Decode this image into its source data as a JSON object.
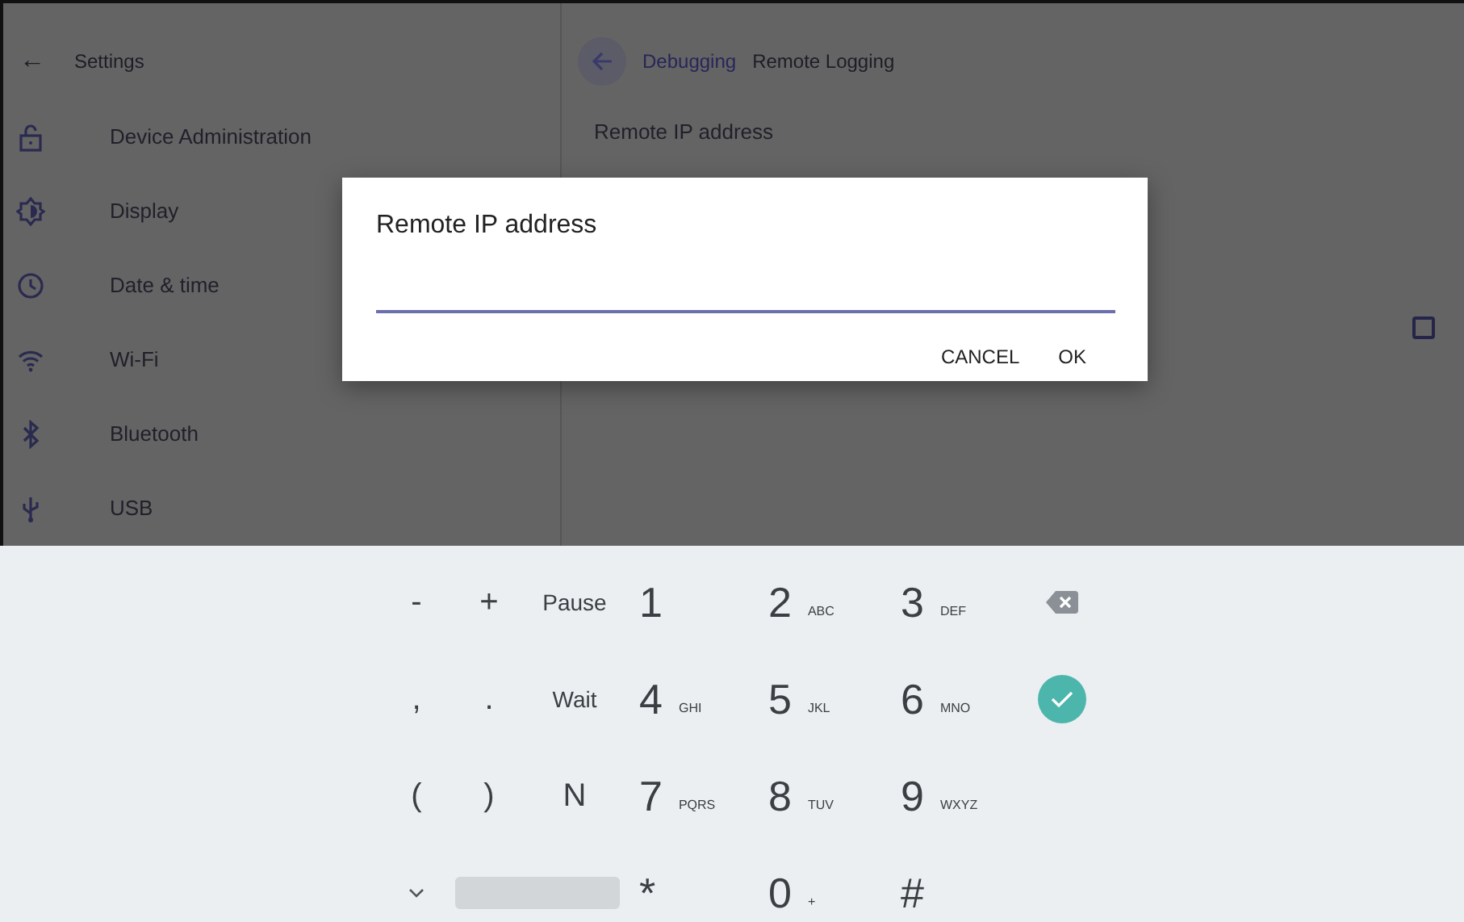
{
  "settings_panel": {
    "back": "←",
    "title": "Settings",
    "items": [
      {
        "label": "Device Administration"
      },
      {
        "label": "Display"
      },
      {
        "label": "Date & time"
      },
      {
        "label": "Wi-Fi"
      },
      {
        "label": "Bluetooth"
      },
      {
        "label": "USB"
      }
    ]
  },
  "detail_panel": {
    "breadcrumb": [
      {
        "label": "Debugging",
        "selected": false
      },
      {
        "label": "Remote Logging",
        "selected": true
      }
    ],
    "setting": {
      "label": "Remote IP address"
    },
    "checkbox": {
      "checked": false
    }
  },
  "dialog": {
    "title": "Remote IP address",
    "buttons": [
      "CANCEL",
      "OK"
    ]
  },
  "keypad": {
    "rows": [
      [
        {
          "kind": "text",
          "label": "-"
        },
        {
          "kind": "text",
          "label": "+"
        },
        {
          "kind": "word",
          "label": "Pause"
        },
        {
          "kind": "digit",
          "label": "1"
        },
        {
          "kind": "digit",
          "label": "2",
          "sub": "ABC"
        },
        {
          "kind": "digit",
          "label": "3",
          "sub": "DEF"
        },
        {
          "kind": "backspace"
        }
      ],
      [
        {
          "kind": "text",
          "label": ","
        },
        {
          "kind": "text",
          "label": "."
        },
        {
          "kind": "word",
          "label": "Wait"
        },
        {
          "kind": "digit",
          "label": "4",
          "sub": "GHI"
        },
        {
          "kind": "digit",
          "label": "5",
          "sub": "JKL"
        },
        {
          "kind": "digit",
          "label": "6",
          "sub": "MNO"
        },
        {
          "kind": "done"
        }
      ],
      [
        {
          "kind": "text",
          "label": "("
        },
        {
          "kind": "text",
          "label": ")"
        },
        {
          "kind": "letter",
          "label": "N"
        },
        {
          "kind": "digit",
          "label": "7",
          "sub": "PQRS"
        },
        {
          "kind": "digit",
          "label": "8",
          "sub": "TUV"
        },
        {
          "kind": "digit",
          "label": "9",
          "sub": "WXYZ"
        }
      ],
      [
        {
          "kind": "collapse"
        },
        {
          "kind": "space"
        },
        "",
        {
          "kind": "digit",
          "label": "*"
        },
        {
          "kind": "digit",
          "label": "0",
          "sub": "+"
        },
        {
          "kind": "digit",
          "label": "#"
        }
      ]
    ]
  }
}
